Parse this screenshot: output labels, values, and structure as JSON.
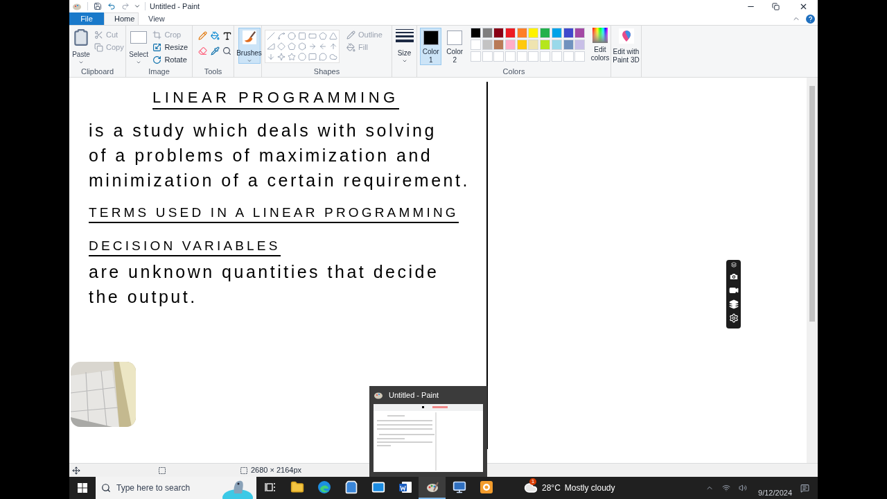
{
  "window": {
    "title": "Untitled - Paint"
  },
  "tabs": [
    {
      "label": "File",
      "kind": "file",
      "selected": false
    },
    {
      "label": "Home",
      "kind": "tab",
      "selected": true
    },
    {
      "label": "View",
      "kind": "tab",
      "selected": false
    }
  ],
  "clipboard": {
    "label": "Clipboard",
    "paste": "Paste",
    "items": [
      {
        "label": "Cut",
        "kind": "cut",
        "disabled": true
      },
      {
        "label": "Copy",
        "kind": "copy",
        "disabled": true
      }
    ]
  },
  "image": {
    "label": "Image",
    "select": "Select",
    "items": [
      {
        "label": "Crop",
        "kind": "crop",
        "disabled": true
      },
      {
        "label": "Resize",
        "kind": "resize",
        "disabled": false
      },
      {
        "label": "Rotate",
        "kind": "rotate",
        "disabled": false
      }
    ]
  },
  "tools": {
    "label": "Tools"
  },
  "brushes": {
    "label": "Brushes",
    "selected": true
  },
  "shapes": {
    "label": "Shapes",
    "items": [
      {
        "label": "Outline",
        "kind": "outline",
        "disabled": true
      },
      {
        "label": "Fill",
        "kind": "fill",
        "disabled": true
      }
    ]
  },
  "size": {
    "label": "Size"
  },
  "colors": {
    "label": "Colors",
    "slots": [
      {
        "label": "Color",
        "number": "1",
        "color": "#000000",
        "selected": true
      },
      {
        "label": "Color",
        "number": "2",
        "color": "#ffffff",
        "selected": false
      }
    ],
    "palette": [
      {
        "color": "#000000"
      },
      {
        "color": "#7f7f7f"
      },
      {
        "color": "#880015"
      },
      {
        "color": "#ed1c24"
      },
      {
        "color": "#ff7f27"
      },
      {
        "color": "#fff200"
      },
      {
        "color": "#22b14c"
      },
      {
        "color": "#00a2e8"
      },
      {
        "color": "#3f48cc"
      },
      {
        "color": "#a349a4"
      },
      {
        "color": "#ffffff"
      },
      {
        "color": "#c3c3c3"
      },
      {
        "color": "#b97a57"
      },
      {
        "color": "#ffaec9"
      },
      {
        "color": "#ffc90e"
      },
      {
        "color": "#efe4b0"
      },
      {
        "color": "#b5e61d"
      },
      {
        "color": "#99d9ea"
      },
      {
        "color": "#7092be"
      },
      {
        "color": "#c8bfe7"
      }
    ],
    "edit": "Edit colors"
  },
  "paint3d": "Edit with Paint 3D",
  "canvas": {
    "lines": [
      {
        "text": "LINEAR PROGRAMMING",
        "kind": "title"
      },
      {
        "text": "is a study which deals with solving",
        "kind": "text"
      },
      {
        "text": "of a problems of maximization and",
        "kind": "text"
      },
      {
        "text": "minimization of a certain requirement.",
        "kind": "text"
      },
      {
        "text": "TERMS USED IN A LINEAR PROGRAMMING",
        "kind": "heading"
      },
      {
        "text": "DECISION VARIABLES",
        "kind": "heading"
      },
      {
        "text": "are unknown quantities that decide",
        "kind": "text"
      },
      {
        "text": "the output.",
        "kind": "text"
      }
    ]
  },
  "status_bar": {
    "dimensions": "2680 × 2164px"
  },
  "preview": {
    "title": "Untitled - Paint"
  },
  "taskbar": {
    "search": {
      "placeholder": "Type here to search"
    },
    "apps": [
      {
        "kind": "taskview",
        "selected": false
      },
      {
        "kind": "explorer",
        "selected": false
      },
      {
        "kind": "edge",
        "selected": false
      },
      {
        "kind": "store",
        "selected": false
      },
      {
        "kind": "mail",
        "selected": false
      },
      {
        "kind": "word",
        "selected": false
      },
      {
        "kind": "paint",
        "selected": true
      },
      {
        "kind": "remote",
        "selected": false
      },
      {
        "kind": "recorder",
        "selected": false
      }
    ],
    "weather": {
      "badge": "1",
      "temperature": "28°C",
      "condition": "Mostly cloudy"
    },
    "date": "9/12/2024"
  }
}
